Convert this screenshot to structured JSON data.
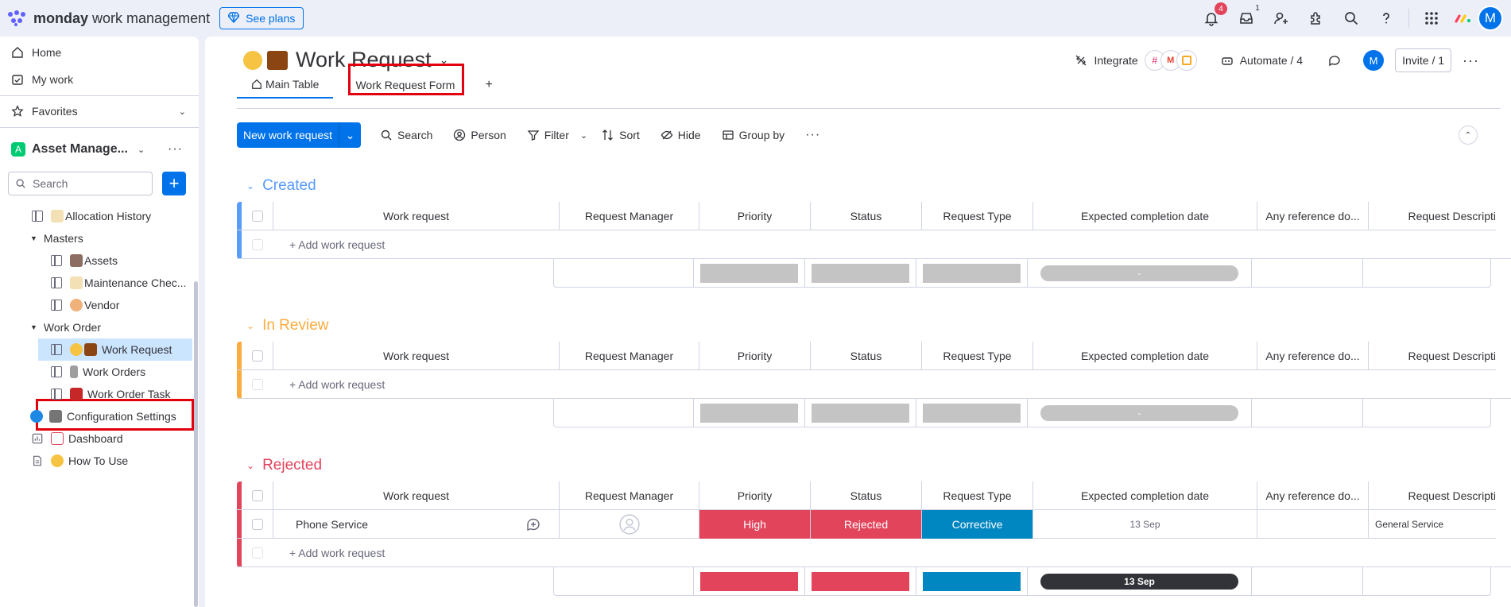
{
  "app": {
    "brand_bold": "monday",
    "brand_rest": " work management",
    "see_plans": "See plans"
  },
  "topbar": {
    "notifications_count": "4",
    "inbox_count": "1",
    "avatar": "M"
  },
  "sidebar": {
    "home": "Home",
    "my_work": "My work",
    "favorites": "Favorites",
    "workspace": "Asset Manage...",
    "workspace_initial": "A",
    "search_placeholder": "Search",
    "items": [
      {
        "label": "Allocation History"
      },
      {
        "label": "Masters"
      },
      {
        "label": "Assets"
      },
      {
        "label": "Maintenance Chec..."
      },
      {
        "label": "Vendor"
      },
      {
        "label": "Work Order"
      },
      {
        "label": "Work Request"
      },
      {
        "label": "Work Orders"
      },
      {
        "label": "Work Order Task"
      },
      {
        "label": "Configuration Settings"
      },
      {
        "label": "Dashboard"
      },
      {
        "label": "How To Use"
      }
    ]
  },
  "board": {
    "title": "Work Request",
    "tabs": [
      {
        "label": "Main Table"
      },
      {
        "label": "Work Request Form"
      },
      {
        "label": "+"
      }
    ],
    "integrate": "Integrate",
    "automate": "Automate / 4",
    "avatar": "M",
    "invite": "Invite / 1"
  },
  "toolbar": {
    "new_item": "New work request",
    "search": "Search",
    "person": "Person",
    "filter": "Filter",
    "sort": "Sort",
    "hide": "Hide",
    "group_by": "Group by"
  },
  "columns": [
    "Work request",
    "Request Manager",
    "Priority",
    "Status",
    "Request Type",
    "Expected completion date",
    "Any reference do...",
    "Request Descripti"
  ],
  "add_item": "+ Add work request",
  "colors": {
    "created": "#579bfc",
    "in_review": "#fdab3d",
    "rejected": "#e2445c",
    "high": "#e2445c",
    "corrective": "#0086c0"
  },
  "groups": [
    {
      "title": "Created",
      "summary_date": "-"
    },
    {
      "title": "In Review",
      "summary_date": "-"
    },
    {
      "title": "Rejected",
      "summary_date": "13 Sep",
      "row": {
        "name": "Phone Service",
        "priority": "High",
        "status": "Rejected",
        "type": "Corrective",
        "date": "13 Sep",
        "description": "General Service"
      }
    }
  ]
}
